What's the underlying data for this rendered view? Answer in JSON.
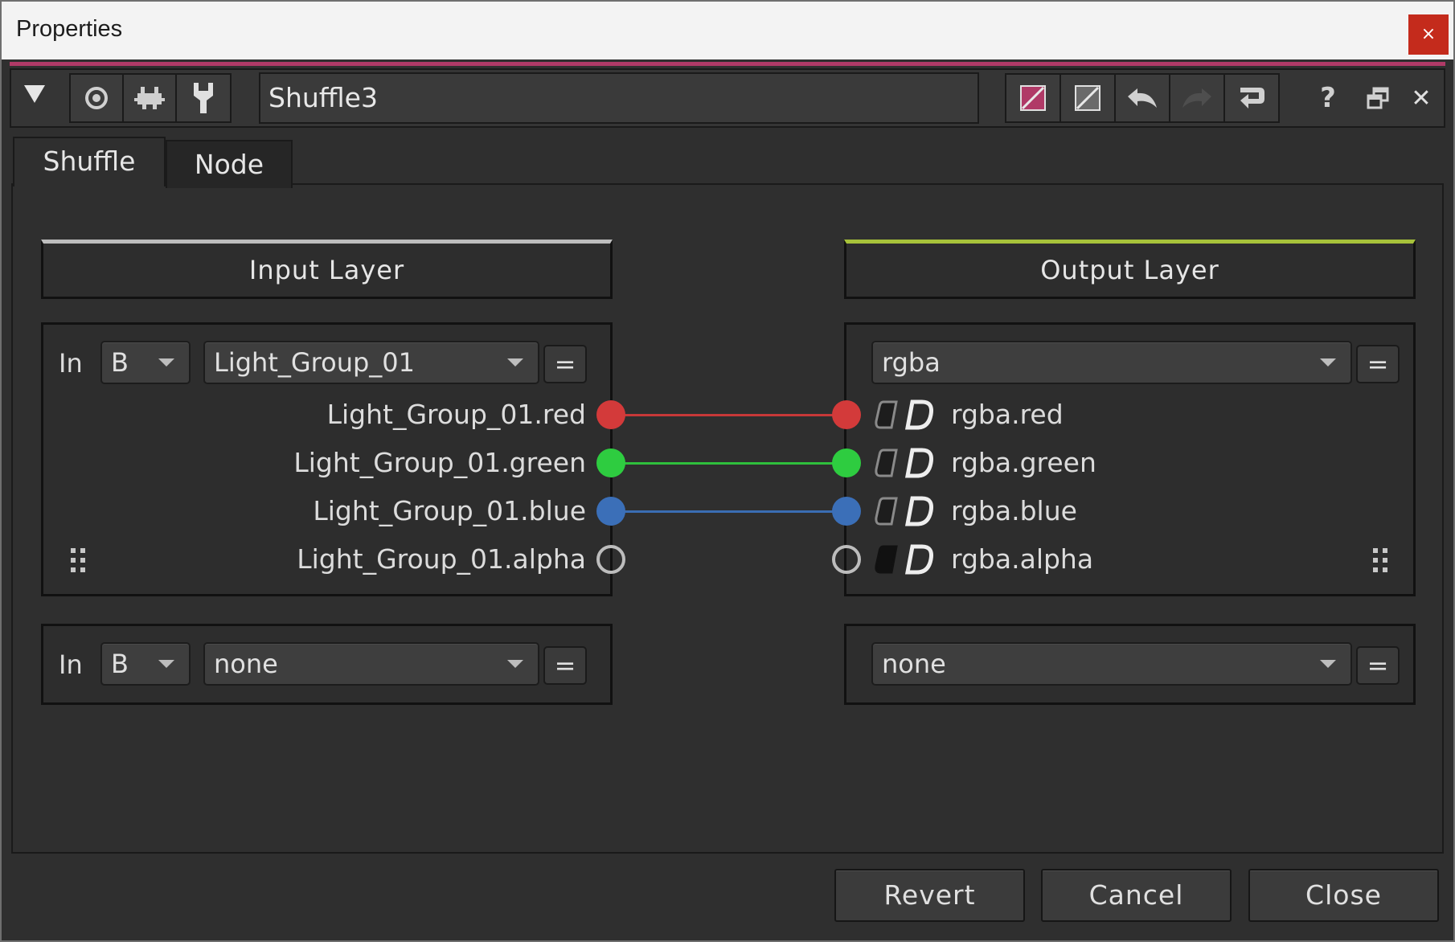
{
  "window": {
    "title": "Properties",
    "close_glyph": "×"
  },
  "toolbar": {
    "node_name": "Shuffle3",
    "icons": [
      "collapse-arrow-icon",
      "viewer-icon",
      "pin-icon",
      "tools-icon",
      "color-swatch-icon",
      "gray-swatch-icon",
      "undo-icon",
      "redo-icon",
      "revert-icon",
      "help-icon",
      "float-window-icon",
      "close-icon"
    ],
    "help_glyph": "?",
    "close_glyph": "✕"
  },
  "tabs": [
    {
      "label": "Shuffle",
      "active": true
    },
    {
      "label": "Node",
      "active": false
    }
  ],
  "input_layer": {
    "header": "Input Layer",
    "header_color": "#bdbdbd",
    "row1": {
      "in_label": "In",
      "input_select": "B",
      "layer_select": "Light_Group_01",
      "eq_label": "="
    },
    "channels": [
      {
        "label": "Light_Group_01.red",
        "color": "#d33a3a"
      },
      {
        "label": "Light_Group_01.green",
        "color": "#2ecc40"
      },
      {
        "label": "Light_Group_01.blue",
        "color": "#3b6fb8"
      },
      {
        "label": "Light_Group_01.alpha",
        "color": "hollow"
      }
    ],
    "row2": {
      "in_label": "In",
      "input_select": "B",
      "layer_select": "none",
      "eq_label": "="
    }
  },
  "output_layer": {
    "header": "Output Layer",
    "header_color": "#a7c23a",
    "row1": {
      "layer_select": "rgba",
      "eq_label": "="
    },
    "channels": [
      {
        "label": "rgba.red",
        "color": "#d33a3a"
      },
      {
        "label": "rgba.green",
        "color": "#2ecc40"
      },
      {
        "label": "rgba.blue",
        "color": "#3b6fb8"
      },
      {
        "label": "rgba.alpha",
        "color": "hollow"
      }
    ],
    "row2": {
      "layer_select": "none",
      "eq_label": "="
    }
  },
  "buttons": {
    "revert": "Revert",
    "cancel": "Cancel",
    "close": "Close"
  }
}
